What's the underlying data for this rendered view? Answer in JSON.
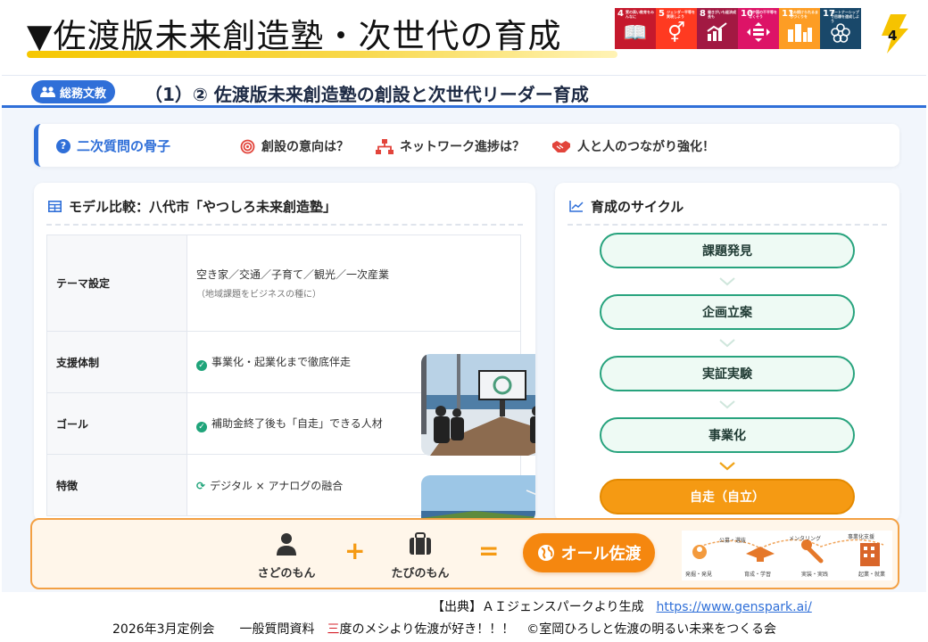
{
  "header": {
    "title": "▼佐渡版未来創造塾・次世代の育成",
    "page_number": "4",
    "sdgs": [
      {
        "num": "4",
        "text": "質の高い教育をみんなに",
        "color": "#c5192d",
        "icon": "book-icon",
        "glyph": "📖"
      },
      {
        "num": "5",
        "text": "ジェンダー平等を実現しよう",
        "color": "#ff3a21",
        "icon": "gender-icon",
        "glyph": "⚥"
      },
      {
        "num": "8",
        "text": "働きがいも経済成長も",
        "color": "#a21942",
        "icon": "growth-chart-icon",
        "glyph": "📈"
      },
      {
        "num": "10",
        "text": "人や国の不平等をなくそう",
        "color": "#dd1367",
        "icon": "equality-icon",
        "glyph": "⇔"
      },
      {
        "num": "11",
        "text": "住み続けられるまちづくりを",
        "color": "#fd9d24",
        "icon": "city-icon",
        "glyph": "▥"
      },
      {
        "num": "17",
        "text": "パートナーシップで目標を達成しよう",
        "color": "#19486a",
        "icon": "flower-icon",
        "glyph": "✿"
      }
    ]
  },
  "panel": {
    "dept_label": "総務文教",
    "title": "（1）② 佐渡版未来創造塾の創設と次世代リーダー育成",
    "questions": {
      "label": "二次質問の骨子",
      "items": [
        "創設の意向は？",
        "ネットワーク進捗は？",
        "人と人のつながり強化！"
      ]
    },
    "model": {
      "title": "モデル比較：八代市「やつしろ未来創造塾」",
      "rows": [
        {
          "key": "テーマ設定",
          "value": "空き家／交通／子育て／観光／一次産業",
          "sub": "（地域課題をビジネスの種に）"
        },
        {
          "key": "支援体制",
          "value": "事業化・起業化まで徹底伴走"
        },
        {
          "key": "ゴール",
          "value": "補助金終了後も「自走」できる人材"
        },
        {
          "key": "特徴",
          "value": "デジタル × アナログの融合"
        }
      ]
    },
    "cycle": {
      "title": "育成のサイクル",
      "steps": [
        "課題発見",
        "企画立案",
        "実証実験",
        "事業化",
        "自走（自立）"
      ]
    },
    "bottom": {
      "item1": "さどのもん",
      "item2": "たびのもん",
      "plus": "+",
      "equals": "=",
      "result": "オール佐渡",
      "flow_labels": [
        "公募・選抜",
        "メンタリング",
        "事業化支援",
        "発掘・発見",
        "育成・学習",
        "実装・実践",
        "起業・就業"
      ]
    }
  },
  "source": {
    "prefix": "【出典】ＡＩジェンスパークより生成",
    "link": "https://www.genspark.ai/"
  },
  "footer": {
    "part1": "2026年3月定例会　　一般質問資料　",
    "red": "三",
    "part2": "度のメシより佐渡が好き！！！　©室岡ひろしと佐渡の明るい未来をつくる会"
  }
}
